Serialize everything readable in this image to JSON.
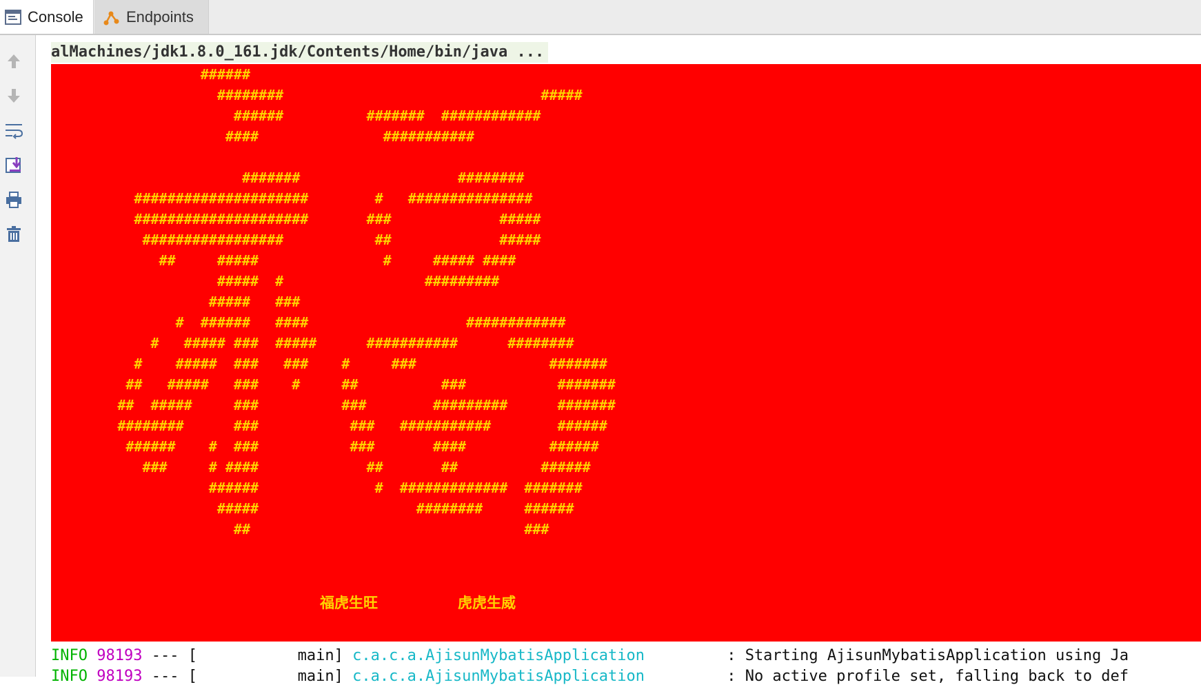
{
  "tabs": [
    {
      "label": "Console",
      "icon": "console-icon",
      "active": true
    },
    {
      "label": "Endpoints",
      "icon": "endpoints-icon",
      "active": false
    }
  ],
  "toolbar": {
    "icons": [
      "up-arrow-icon",
      "down-arrow-icon",
      "soft-wrap-icon",
      "scroll-to-end-icon",
      "print-icon",
      "trash-icon"
    ]
  },
  "console": {
    "command_line": "alMachines/jdk1.8.0_161.jdk/Contents/Home/bin/java ...",
    "banner": {
      "background": "#ff0000",
      "text_color": "#ffd200",
      "art": "                  ######\n                    ########                               #####\n                      ######          #######  ############\n                     ####               ###########\n\n                       #######                   ########\n          #####################        #   ###############\n          #####################       ###             #####\n           #################           ##             #####\n             ##     #####               #     ##### ####\n                    #####  #                 #########\n                   #####   ###\n               #  ######   ####                   ############\n            #   ##### ###  #####      ###########      ########\n          #    #####  ###   ###    #     ###                #######\n         ##   #####   ###    #     ##          ###           #######\n        ##  #####     ###          ###        #########      #######\n        ########      ###           ###   ###########        ######\n         ######    #  ###           ###       ####          ######\n           ###     # ####             ##       ##          ######\n                   ######              #  #############  #######\n                    #####                   ########     ######\n                      ##                                 ###",
      "caption_left": "福虎生旺",
      "caption_right": "虎虎生威"
    },
    "log_lines": [
      {
        "level": "INFO",
        "pid": "98193",
        "sep": "---",
        "thread": "[           main]",
        "logger": "c.a.c.a.AjisunMybatisApplication",
        "message": ": Starting AjisunMybatisApplication using Ja"
      },
      {
        "level": "INFO",
        "pid": "98193",
        "sep": "---",
        "thread": "[           main]",
        "logger": "c.a.c.a.AjisunMybatisApplication",
        "message": ": No active profile set, falling back to def"
      }
    ]
  }
}
